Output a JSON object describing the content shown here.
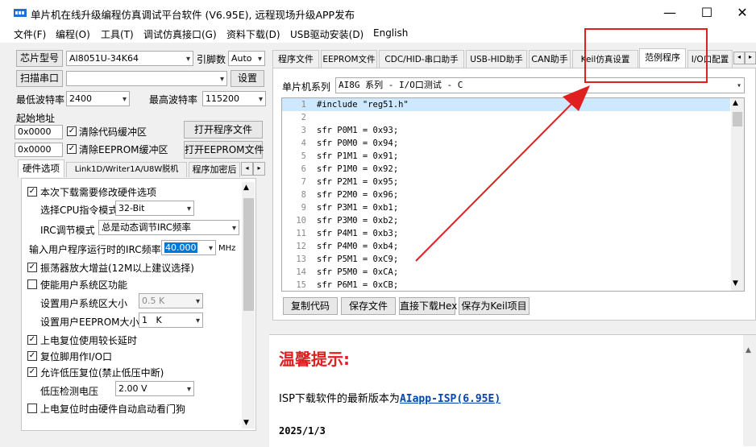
{
  "window": {
    "title": "单片机在线升级编程仿真调试平台软件 (V6.95E), 远程现场升级APP发布",
    "minimize": "—",
    "maximize": "☐",
    "close": "✕"
  },
  "menu": [
    "文件(F)",
    "编程(O)",
    "工具(T)",
    "调试仿真接口(G)",
    "资料下载(D)",
    "USB驱动安装(D)",
    "English"
  ],
  "left": {
    "chip_model_btn": "芯片型号",
    "chip_model_value": "AI8051U-34K64",
    "pin_count_label": "引脚数",
    "pin_count_value": "Auto",
    "scan_port_btn": "扫描串口",
    "port_value": "",
    "settings_btn": "设置",
    "min_baud_label": "最低波特率",
    "min_baud_value": "2400",
    "max_baud_label": "最高波特率",
    "max_baud_value": "115200",
    "start_addr_label": "起始地址",
    "addr1": "0x0000",
    "clear_code_label": "清除代码缓冲区",
    "open_program_btn": "打开程序文件",
    "addr2": "0x0000",
    "clear_eeprom_label": "清除EEPROM缓冲区",
    "open_eeprom_btn": "打开EEPROM文件",
    "subtabs": [
      "硬件选项",
      "Link1D/Writer1A/U8W脱机",
      "程序加密后"
    ],
    "options": {
      "modify_hw": "本次下载需要修改硬件选项",
      "cpu_mode_label": "选择CPU指令模式",
      "cpu_mode_value": "32-Bit",
      "irc_mode_label": "IRC调节模式",
      "irc_mode_value": "总是动态调节IRC频率",
      "irc_freq_label": "输入用户程序运行时的IRC频率",
      "irc_freq_value": "40.000",
      "irc_freq_unit": "MHz",
      "osc_gain": "振荡器放大增益(12M以上建议选择)",
      "user_sys_area": "使能用户系统区功能",
      "sys_area_size_label": "设置用户系统区大小",
      "sys_area_size_value": "0.5 K",
      "eeprom_size_label": "设置用户EEPROM大小",
      "eeprom_size_value": "1   K",
      "long_delay": "上电复位使用较长延时",
      "reset_as_io": "复位脚用作I/O口",
      "lvr": "允许低压复位(禁止低压中断)",
      "lvd_label": "低压检测电压",
      "lvd_value": "2.00 V",
      "watchdog": "上电复位时由硬件自动启动看门狗"
    }
  },
  "right": {
    "tabs": [
      "程序文件",
      "EEPROM文件",
      "CDC/HID-串口助手",
      "USB-HID助手",
      "CAN助手",
      "Keil仿真设置",
      "范例程序",
      "I/O口配置"
    ],
    "series_label": "单片机系列",
    "series_value": "AI8G 系列 - I/O口测试 - C",
    "code": [
      {
        "n": "1",
        "t": "#include \"reg51.h\""
      },
      {
        "n": "2",
        "t": ""
      },
      {
        "n": "3",
        "t": "sfr P0M1 = 0x93;"
      },
      {
        "n": "4",
        "t": "sfr P0M0 = 0x94;"
      },
      {
        "n": "5",
        "t": "sfr P1M1 = 0x91;"
      },
      {
        "n": "6",
        "t": "sfr P1M0 = 0x92;"
      },
      {
        "n": "7",
        "t": "sfr P2M1 = 0x95;"
      },
      {
        "n": "8",
        "t": "sfr P2M0 = 0x96;"
      },
      {
        "n": "9",
        "t": "sfr P3M1 = 0xb1;"
      },
      {
        "n": "10",
        "t": "sfr P3M0 = 0xb2;"
      },
      {
        "n": "11",
        "t": "sfr P4M1 = 0xb3;"
      },
      {
        "n": "12",
        "t": "sfr P4M0 = 0xb4;"
      },
      {
        "n": "13",
        "t": "sfr P5M1 = 0xC9;"
      },
      {
        "n": "14",
        "t": "sfr P5M0 = 0xCA;"
      },
      {
        "n": "15",
        "t": "sfr P6M1 = 0xCB;"
      }
    ],
    "btn_copy": "复制代码",
    "btn_save": "保存文件",
    "btn_download": "直接下载Hex",
    "btn_keil": "保存为Keil项目",
    "notice_title": "温馨提示:",
    "notice_line_prefix": "ISP下载软件的最新版本为",
    "notice_link": "AIapp-ISP(6.95E)",
    "notice_date": "2025/1/3"
  },
  "colors": {
    "accent_red": "#e02020",
    "link": "#0645ad",
    "highlight_line": "#cde8ff"
  }
}
